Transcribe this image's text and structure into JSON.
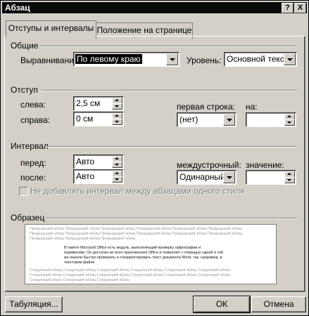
{
  "window": {
    "title": "Абзац",
    "help_button": "?",
    "close_button": "X"
  },
  "tabs": [
    {
      "label": "Отступы и интервалы",
      "active": true
    },
    {
      "label": "Положение на странице",
      "active": false
    }
  ],
  "general": {
    "heading": "Общие",
    "alignment_label": "Выравнивание:",
    "alignment_value": "По левому краю",
    "level_label": "Уровень:",
    "level_value": "Основной текст"
  },
  "indent": {
    "heading": "Отступ",
    "left_label": "слева:",
    "left_value": "2,5 см",
    "right_label": "справа:",
    "right_value": "0 см",
    "first_line_label": "первая строка:",
    "first_line_value": "(нет)",
    "by_label": "на:",
    "by_value": ""
  },
  "spacing": {
    "heading": "Интервал",
    "before_label": "перед:",
    "before_value": "Авто",
    "after_label": "после:",
    "after_value": "Авто",
    "line_label": "междустрочный:",
    "line_value": "Одинарный",
    "at_label": "значение:",
    "at_value": "",
    "no_space_label": "Не добавлять интервал между абзацами одного стиля"
  },
  "preview": {
    "heading": "Образец",
    "gray_line": "Предыдущий абзац Предыдущий абзац Предыдущий абзац Предыдущий абзац Предыдущий абзац Предыдущий абзац",
    "gray_line_short": "Предыдущий абзац Предыдущий абзац Предыдущий абзац",
    "sample_lines": [
      "В пакете Microsoft Office есть модуль, выполняющий проверку орфографии и",
      "грамматики. Он доступен во всех приложениях Office и позволяет с помощью одной и той",
      "же панели быстро проверить и откорректировать текст документа Word, так, например, в",
      "текстовом файле"
    ],
    "next_line": "Следующий абзац Следующий абзац Следующий абзац Следующий абзац Следующий абзац Следующий абзац",
    "next_line_short": "Следующий абзац Следующий абзац Следующий абзац"
  },
  "buttons": {
    "tabs": "Табуляция...",
    "ok": "ОК",
    "cancel": "Отмена"
  }
}
